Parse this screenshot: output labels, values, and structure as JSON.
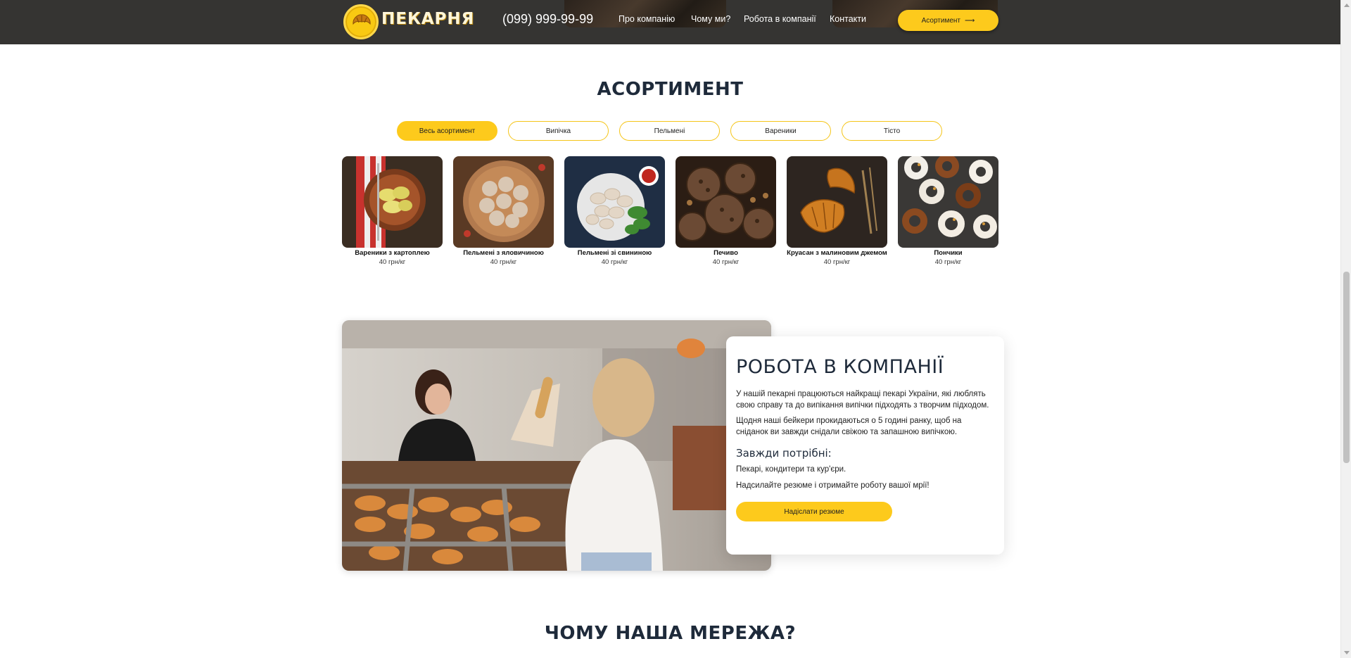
{
  "header": {
    "logo_text": "ПЕКАРНЯ",
    "phone": "(099) 999-99-99",
    "nav": [
      "Про компанію",
      "Чому ми?",
      "Робота в компанії",
      "Контакти"
    ],
    "cta_label": "Асортимент",
    "cta_arrow": "⟶"
  },
  "assortment": {
    "title": "АСОРТИМЕНТ",
    "filters": [
      "Весь асортимент",
      "Випічка",
      "Пельмені",
      "Вареники",
      "Тісто"
    ],
    "active_filter": "Весь асортимент",
    "products": [
      {
        "name": "Вареники з картоплею",
        "price": "40 грн/кг"
      },
      {
        "name": "Пельмені з яловичиною",
        "price": "40 грн/кг"
      },
      {
        "name": "Пельмені зі свининою",
        "price": "40 грн/кг"
      },
      {
        "name": "Печиво",
        "price": "40 грн/кг"
      },
      {
        "name": "Круасан з малиновим джемом",
        "price": "40 грн/кг"
      },
      {
        "name": "Пончики",
        "price": "40 грн/кг"
      }
    ]
  },
  "career": {
    "title": "РОБОТА В КОМПАНІЇ",
    "p1": "У нашій пекарні працюються найкращі пекарі України, які люблять свою справу та до випікання випічки підходять з творчим підходом.",
    "p2": "Щодня наші бейкери прокидаються о 5 годині ранку, щоб на сніданок ви завжди снідали свіжою та запашною випічкою.",
    "subtitle": "Завжди потрібні:",
    "p3": "Пекарі, кондитери та кур'єри.",
    "p4": "Надсилайте резюме і отримайте роботу вашої мрії!",
    "button_label": "Надіслати резюме"
  },
  "why": {
    "title": "ЧОМУ НАША МЕРЕЖА?"
  },
  "colors": {
    "accent": "#fdca1c",
    "header_bg": "#353432",
    "title": "#1e2a3a"
  }
}
